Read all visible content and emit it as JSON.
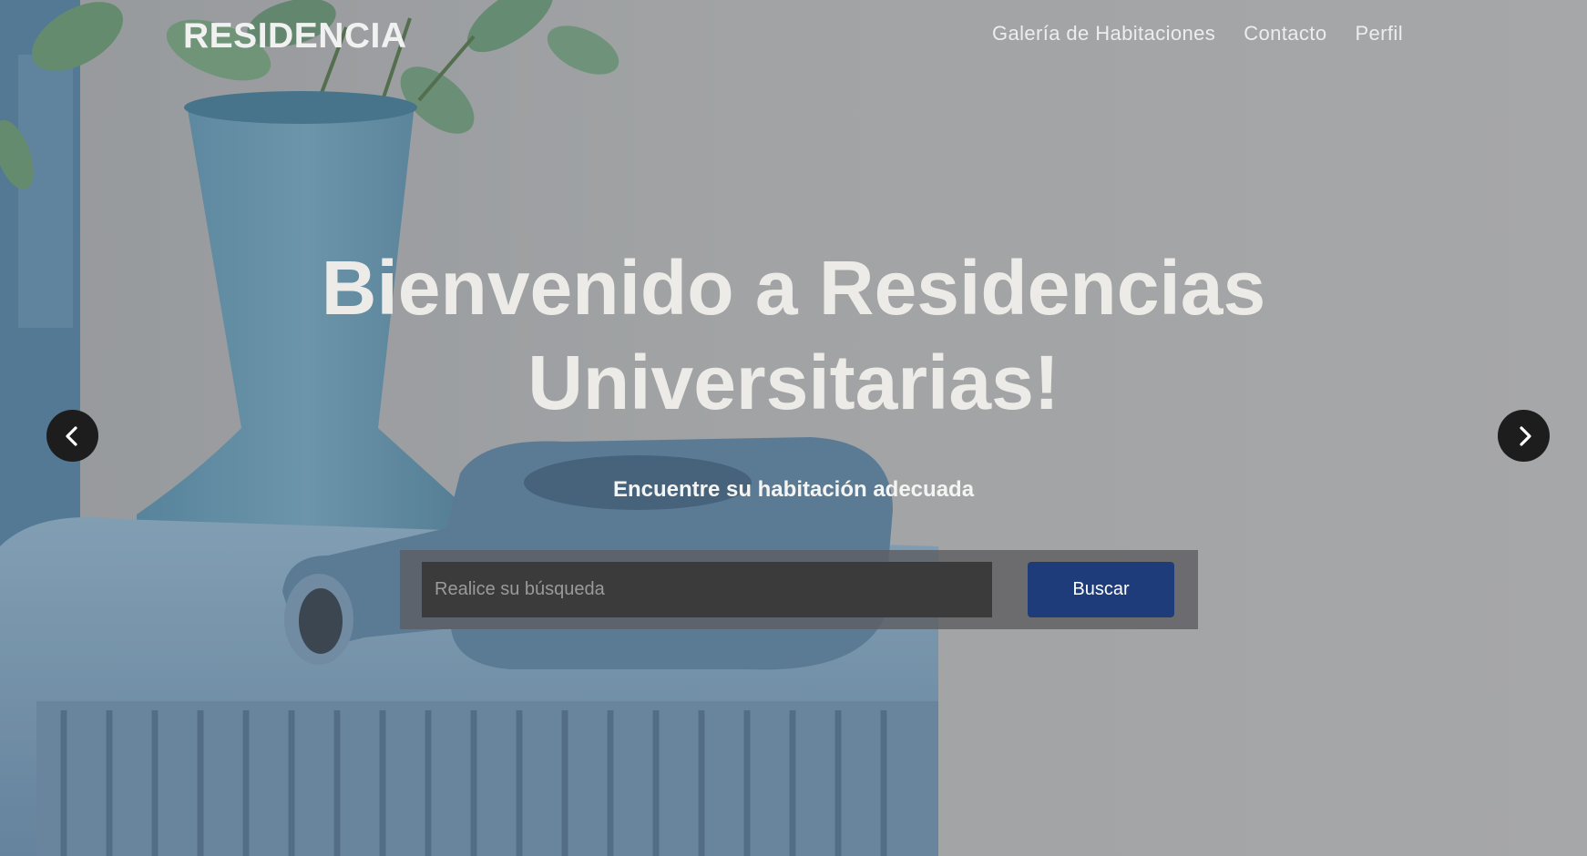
{
  "navbar": {
    "brand": "RESIDENCIA",
    "links": [
      "Galería de Habitaciones",
      "Contacto",
      "Perfil"
    ]
  },
  "hero": {
    "title_line1": "Bienvenido a Residencias",
    "title_line2": "Universitarias!",
    "subtitle": "Encuentre su habitación adecuada"
  },
  "search": {
    "placeholder": "Realice su búsqueda",
    "value": "",
    "button_label": "Buscar"
  },
  "carousel": {
    "prev_icon": "chevron-left-icon",
    "next_icon": "chevron-right-icon"
  },
  "colors": {
    "button": "#1f3c7a",
    "vase": "#6b9bb4",
    "wall": "#b6b7b9"
  }
}
